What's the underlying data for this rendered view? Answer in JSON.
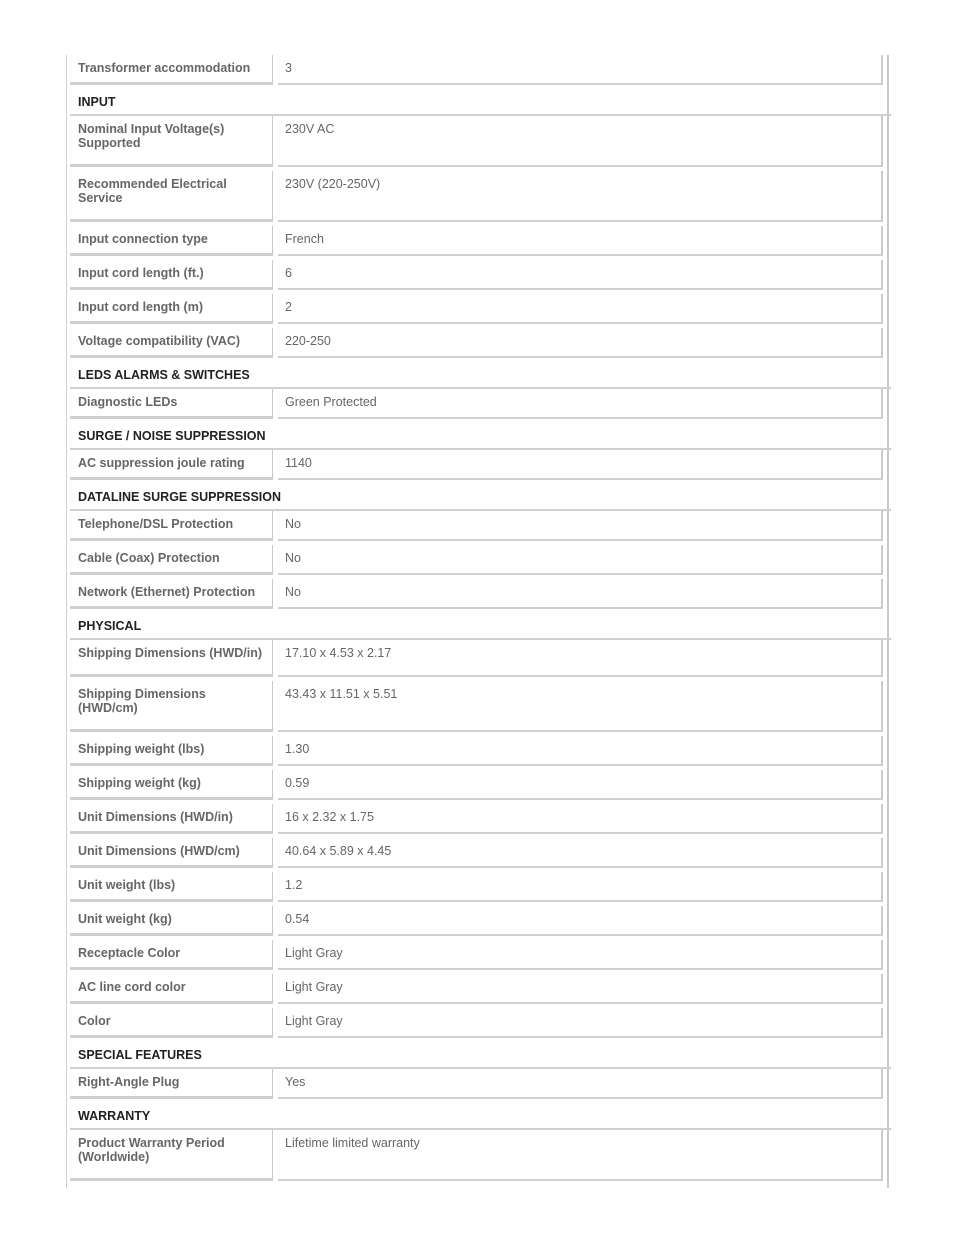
{
  "rows": [
    {
      "type": "row",
      "label": "Transformer accommodation",
      "value": "3"
    },
    {
      "type": "section",
      "title": "INPUT"
    },
    {
      "type": "row",
      "label": "Nominal Input Voltage(s) Supported",
      "value": "230V AC",
      "tall": true
    },
    {
      "type": "row",
      "label": "Recommended Electrical Service",
      "value": "230V (220-250V)",
      "tall": true
    },
    {
      "type": "row",
      "label": "Input connection type",
      "value": "French"
    },
    {
      "type": "row",
      "label": "Input cord length (ft.)",
      "value": "6"
    },
    {
      "type": "row",
      "label": "Input cord length (m)",
      "value": "2"
    },
    {
      "type": "row",
      "label": "Voltage compatibility (VAC)",
      "value": "220-250"
    },
    {
      "type": "section",
      "title": "LEDS ALARMS & SWITCHES"
    },
    {
      "type": "row",
      "label": "Diagnostic LEDs",
      "value": "Green Protected"
    },
    {
      "type": "section",
      "title": "SURGE / NOISE SUPPRESSION"
    },
    {
      "type": "row",
      "label": "AC suppression joule rating",
      "value": "1140"
    },
    {
      "type": "section",
      "title": "DATALINE SURGE SUPPRESSION"
    },
    {
      "type": "row",
      "label": "Telephone/DSL Protection",
      "value": "No"
    },
    {
      "type": "row",
      "label": "Cable (Coax) Protection",
      "value": "No"
    },
    {
      "type": "row",
      "label": "Network (Ethernet) Protection",
      "value": "No"
    },
    {
      "type": "section",
      "title": "PHYSICAL"
    },
    {
      "type": "row",
      "label": "Shipping Dimensions (HWD/in)",
      "value": "17.10 x 4.53 x 2.17",
      "tall": true
    },
    {
      "type": "row",
      "label": "Shipping Dimensions (HWD/cm)",
      "value": "43.43 x 11.51 x 5.51",
      "tall": true
    },
    {
      "type": "row",
      "label": "Shipping weight (lbs)",
      "value": "1.30"
    },
    {
      "type": "row",
      "label": "Shipping weight (kg)",
      "value": "0.59"
    },
    {
      "type": "row",
      "label": "Unit Dimensions (HWD/in)",
      "value": "16 x 2.32 x 1.75"
    },
    {
      "type": "row",
      "label": "Unit Dimensions (HWD/cm)",
      "value": "40.64 x 5.89 x 4.45"
    },
    {
      "type": "row",
      "label": "Unit weight (lbs)",
      "value": "1.2"
    },
    {
      "type": "row",
      "label": "Unit weight (kg)",
      "value": "0.54"
    },
    {
      "type": "row",
      "label": "Receptacle Color",
      "value": "Light Gray"
    },
    {
      "type": "row",
      "label": "AC line cord color",
      "value": "Light Gray"
    },
    {
      "type": "row",
      "label": "Color",
      "value": "Light Gray"
    },
    {
      "type": "section",
      "title": "SPECIAL FEATURES"
    },
    {
      "type": "row",
      "label": "Right-Angle Plug",
      "value": "Yes"
    },
    {
      "type": "section",
      "title": "WARRANTY"
    },
    {
      "type": "row",
      "label": "Product Warranty Period (Worldwide)",
      "value": "Lifetime limited warranty",
      "tall": true
    }
  ]
}
